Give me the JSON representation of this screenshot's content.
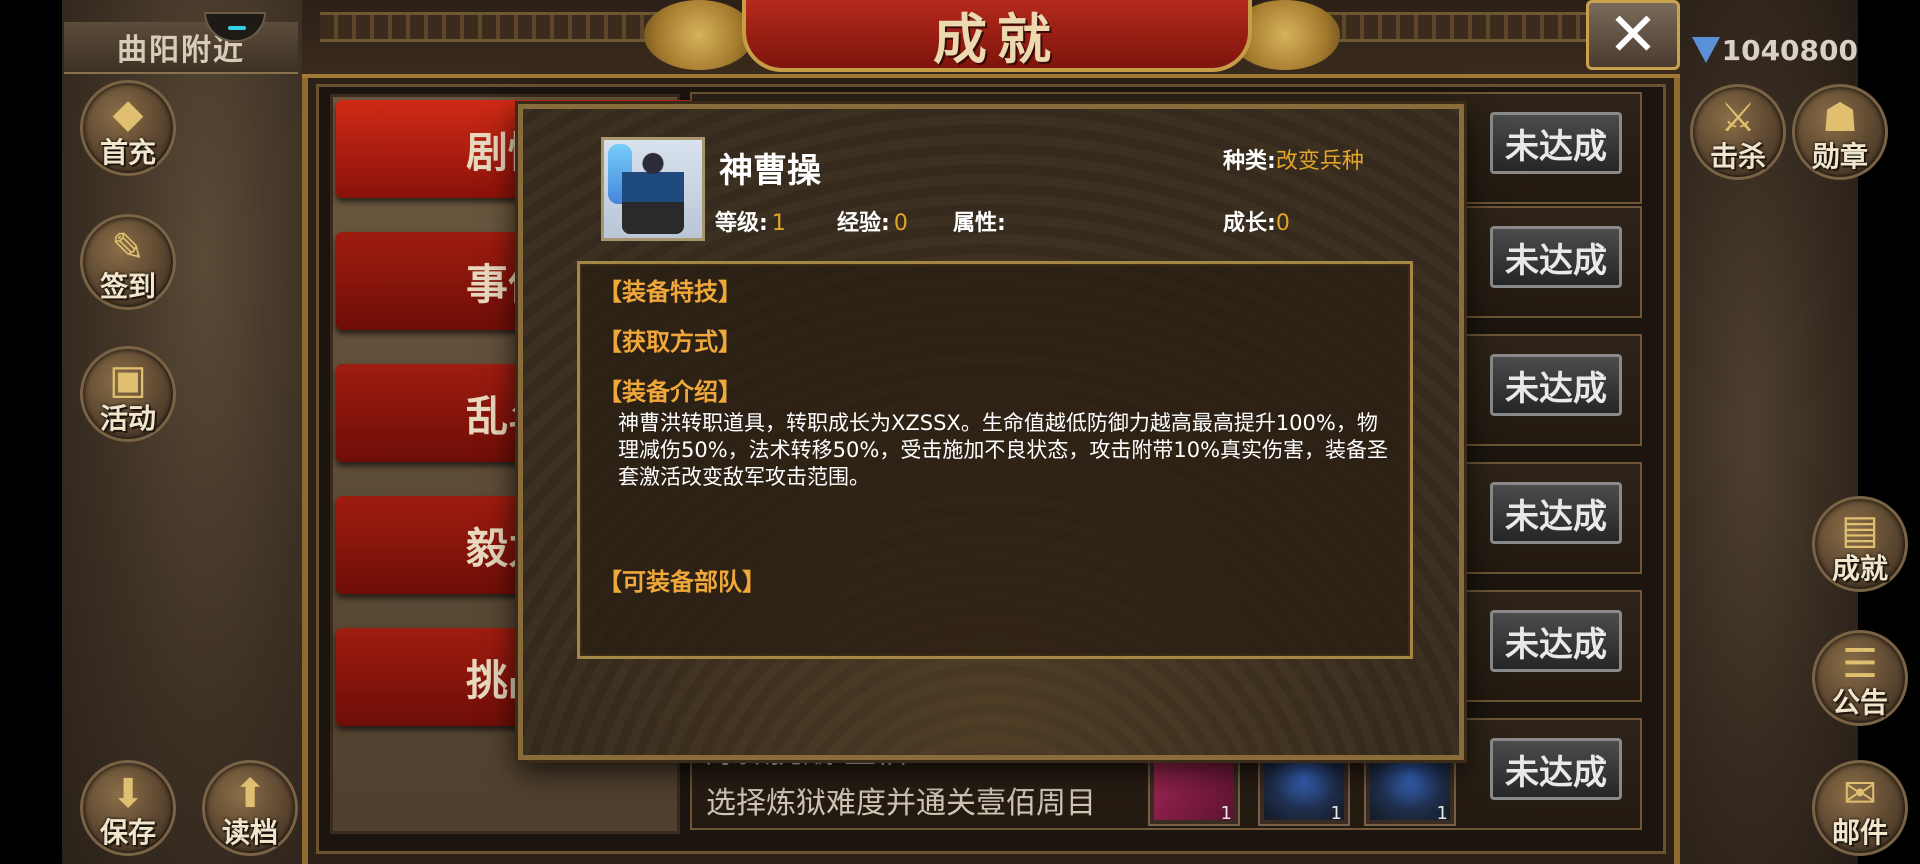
{
  "location": "曲阳附近",
  "currency_value": "1040800",
  "left_buttons": [
    {
      "label": "首充",
      "icon": "gold-ingot-icon"
    },
    {
      "label": "签到",
      "icon": "brush-scroll-icon"
    },
    {
      "label": "活动",
      "icon": "treasure-chest-icon"
    },
    {
      "label": "保存",
      "icon": "save-arrow-icon"
    },
    {
      "label": "读档",
      "icon": "load-arrow-icon"
    }
  ],
  "right_buttons": [
    {
      "label": "击杀",
      "icon": "crossed-swords-icon"
    },
    {
      "label": "勋章",
      "icon": "medal-mask-icon"
    },
    {
      "label": "成就",
      "icon": "achievement-book-icon"
    },
    {
      "label": "公告",
      "icon": "scroll-icon"
    },
    {
      "label": "邮件",
      "icon": "mail-icon"
    }
  ],
  "window_title": "成就",
  "close_label": "✕",
  "categories": [
    {
      "label": "剧情"
    },
    {
      "label": "事件"
    },
    {
      "label": "乱斗"
    },
    {
      "label": "毅力"
    },
    {
      "label": "挑战"
    }
  ],
  "rows": [
    {
      "status": "未达成"
    },
    {
      "status": "未达成"
    },
    {
      "status": "未达成"
    },
    {
      "status": "未达成"
    },
    {
      "status": "未达成"
    },
    {
      "status": "未达成",
      "title": "炼狱挑战·壹佰",
      "desc": "选择炼狱难度并通关壹佰周目",
      "rewards": [
        "1",
        "1",
        "1"
      ]
    }
  ],
  "popup": {
    "unit_name": "神曹操",
    "kind_label": "种类:",
    "kind_value": "改变兵种",
    "level_label": "等级:",
    "level_value": "1",
    "exp_label": "经验:",
    "exp_value": "0",
    "attr_label": "属性:",
    "attr_value": "",
    "growth_label": "成长:",
    "growth_value": "0",
    "sections": {
      "skill": "【装备特技】",
      "obtain": "【获取方式】",
      "intro": "【装备介绍】",
      "troops": "【可装备部队】"
    },
    "description": "神曹洪转职道具，转职成长为XZSSX。生命值越低防御力越高最高提升100%，物理减伤50%，法术转移50%，受击施加不良状态，攻击附带10%真实伤害，装备圣套激活改变敌军攻击范围。"
  }
}
